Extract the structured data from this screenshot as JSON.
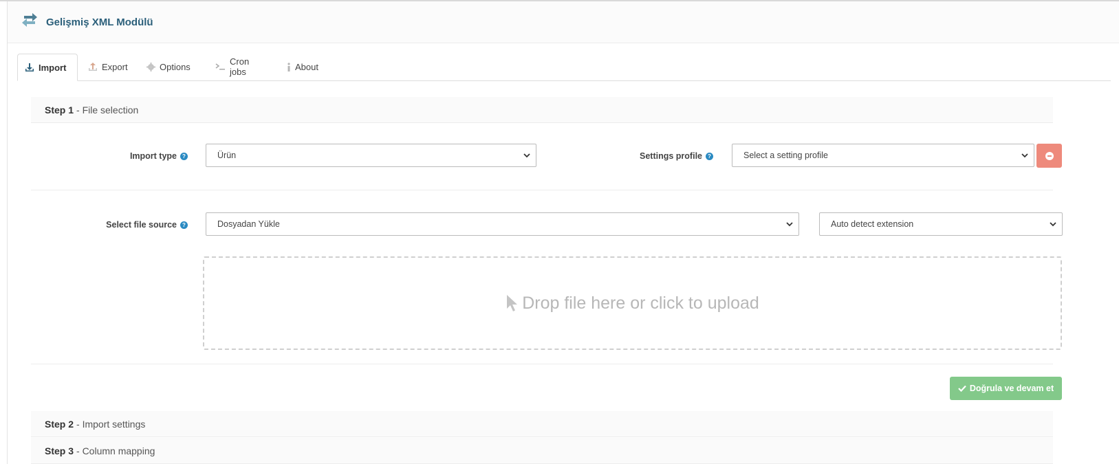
{
  "header": {
    "title": "Gelişmiş XML Modülü",
    "icon": "sync-arrows-icon"
  },
  "tabs": [
    {
      "label": "Import",
      "icon": "download-icon",
      "active": true
    },
    {
      "label": "Export",
      "icon": "upload-icon",
      "active": false
    },
    {
      "label": "Options",
      "icon": "gear-icon",
      "active": false
    },
    {
      "label": "Cron jobs",
      "icon": "terminal-icon",
      "active": false
    },
    {
      "label": "About",
      "icon": "info-icon",
      "active": false
    }
  ],
  "step1": {
    "number": "Step 1",
    "title": "- File selection",
    "import_type": {
      "label": "Import type",
      "value": "Ürün"
    },
    "settings_profile": {
      "label": "Settings profile",
      "value": "Select a setting profile"
    },
    "file_source": {
      "label": "Select file source",
      "value": "Dosyadan Yükle"
    },
    "extension": {
      "value": "Auto detect extension"
    },
    "dropzone_text": "Drop file here or click to upload",
    "continue_label": "Doğrula ve devam et"
  },
  "step2": {
    "number": "Step 2",
    "title": "- Import settings"
  },
  "step3": {
    "number": "Step 3",
    "title": "- Column mapping"
  },
  "colors": {
    "accent": "#2b5f7a",
    "help": "#2a8ac2",
    "danger": "#ee8a7c",
    "success": "#83c98a"
  }
}
